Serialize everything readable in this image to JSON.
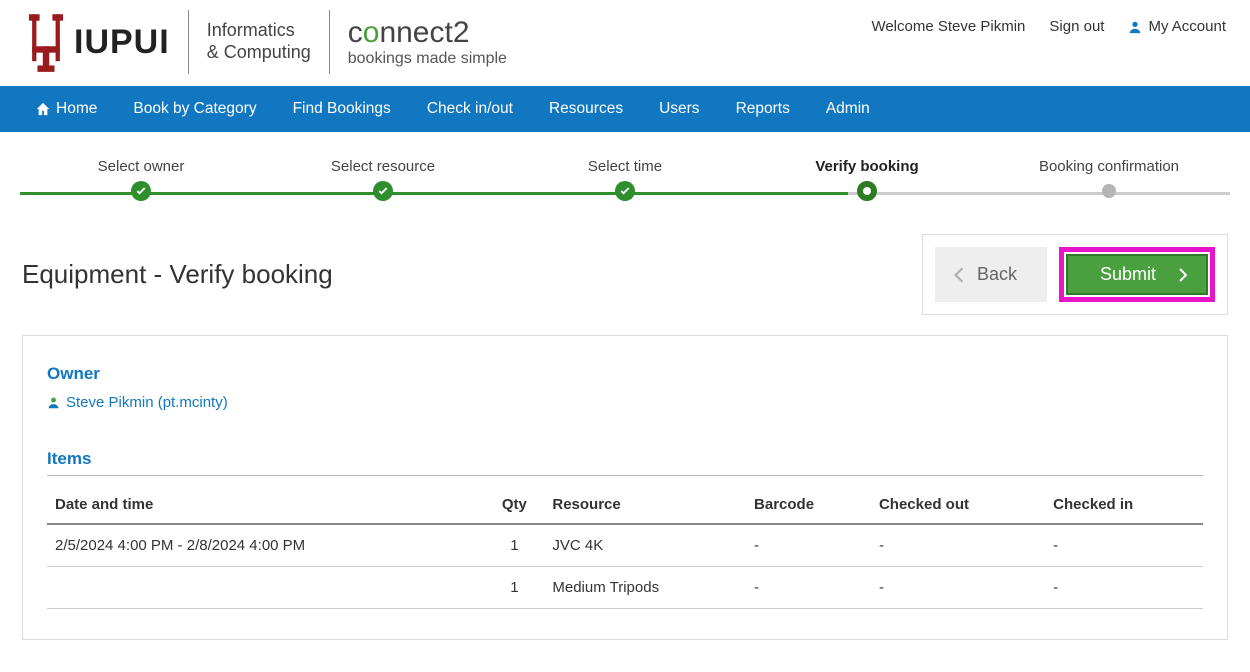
{
  "header": {
    "welcome": "Welcome Steve Pikmin",
    "sign_out": "Sign out",
    "my_account": "My Account",
    "dept_line1": "Informatics",
    "dept_line2": "& Computing",
    "c2_title_pre": "c",
    "c2_title_o": "o",
    "c2_title_post": "nnect2",
    "c2_sub": "bookings made simple"
  },
  "nav": {
    "home": "Home",
    "book": "Book by Category",
    "find": "Find Bookings",
    "check": "Check in/out",
    "resources": "Resources",
    "users": "Users",
    "reports": "Reports",
    "admin": "Admin"
  },
  "stepper": {
    "s1": "Select owner",
    "s2": "Select resource",
    "s3": "Select time",
    "s4": "Verify booking",
    "s5": "Booking confirmation"
  },
  "page": {
    "title": "Equipment - Verify booking",
    "back": "Back",
    "submit": "Submit"
  },
  "owner": {
    "section": "Owner",
    "name": "Steve Pikmin (pt.mcinty)"
  },
  "items": {
    "section": "Items",
    "cols": {
      "datetime": "Date and time",
      "qty": "Qty",
      "resource": "Resource",
      "barcode": "Barcode",
      "checked_out": "Checked out",
      "checked_in": "Checked in"
    },
    "rows": [
      {
        "datetime": "2/5/2024 4:00 PM - 2/8/2024 4:00 PM",
        "qty": "1",
        "resource": "JVC 4K",
        "barcode": "-",
        "checked_out": "-",
        "checked_in": "-"
      },
      {
        "datetime": "",
        "qty": "1",
        "resource": "Medium Tripods",
        "barcode": "-",
        "checked_out": "-",
        "checked_in": "-"
      }
    ]
  }
}
